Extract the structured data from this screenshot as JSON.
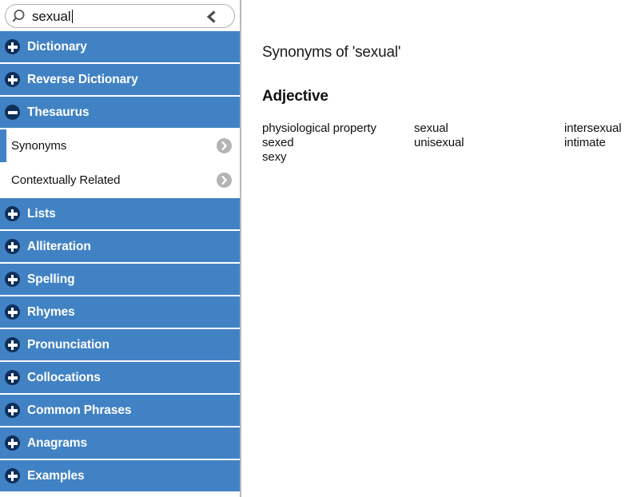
{
  "search": {
    "value": "sexual",
    "placeholder": "Search",
    "search_icon": "search-icon",
    "back_icon": "chevron-left-icon"
  },
  "sidebar": {
    "sections": [
      {
        "label": "Dictionary",
        "icon": "plus-icon",
        "expanded": false
      },
      {
        "label": "Reverse Dictionary",
        "icon": "plus-icon",
        "expanded": false
      },
      {
        "label": "Thesaurus",
        "icon": "minus-icon",
        "expanded": true,
        "children": [
          {
            "label": "Synonyms",
            "active": true,
            "icon": "chevron-right-circle-icon"
          },
          {
            "label": "Contextually Related",
            "active": false,
            "icon": "chevron-right-circle-icon"
          }
        ]
      },
      {
        "label": "Lists",
        "icon": "plus-icon",
        "expanded": false
      },
      {
        "label": "Alliteration",
        "icon": "plus-icon",
        "expanded": false
      },
      {
        "label": "Spelling",
        "icon": "plus-icon",
        "expanded": false
      },
      {
        "label": "Rhymes",
        "icon": "plus-icon",
        "expanded": false
      },
      {
        "label": "Pronunciation",
        "icon": "plus-icon",
        "expanded": false
      },
      {
        "label": "Collocations",
        "icon": "plus-icon",
        "expanded": false
      },
      {
        "label": "Common Phrases",
        "icon": "plus-icon",
        "expanded": false
      },
      {
        "label": "Anagrams",
        "icon": "plus-icon",
        "expanded": false
      },
      {
        "label": "Examples",
        "icon": "plus-icon",
        "expanded": false
      }
    ]
  },
  "main": {
    "title": "Synonyms of 'sexual'",
    "pos_heading": "Adjective",
    "columns": [
      [
        "physiological property",
        "sexed",
        "sexy"
      ],
      [
        "sexual",
        "unisexual"
      ],
      [
        "intersexual",
        "intimate"
      ]
    ]
  },
  "colors": {
    "accent_blue": "#4182c4",
    "icon_navy": "#10305c",
    "chevron_gray": "#b4b4b4",
    "border_gray": "#b8b8b8",
    "text_dark": "#111111"
  }
}
